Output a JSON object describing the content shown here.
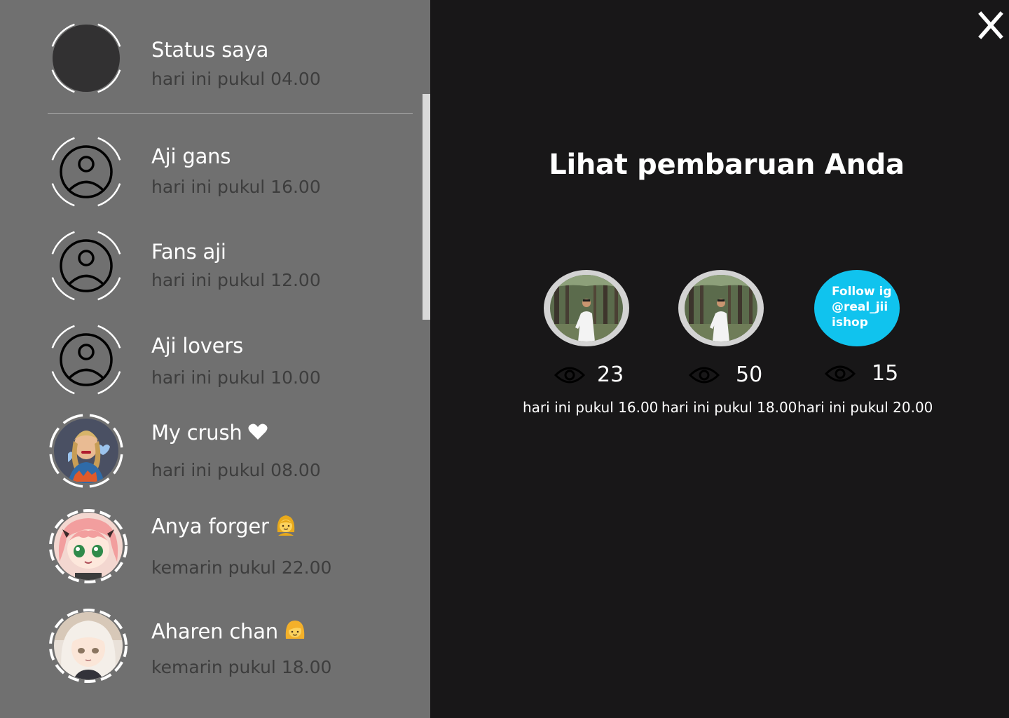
{
  "status_list": {
    "my_status": {
      "name": "Status saya",
      "time": "hari ini pukul 04.00"
    },
    "contacts": [
      {
        "name": "Aji gans",
        "time": "hari ini pukul 16.00"
      },
      {
        "name": "Fans aji",
        "time": "hari ini pukul 12.00"
      },
      {
        "name": "Aji lovers",
        "time": "hari ini pukul 10.00"
      },
      {
        "name": "My crush",
        "time": "hari ini pukul 08.00",
        "icon": "heart-icon"
      },
      {
        "name": "Anya forger",
        "time": "kemarin pukul 22.00",
        "icon": "girl-emoji-icon"
      },
      {
        "name": "Aharen chan",
        "time": "kemarin pukul 18.00",
        "icon": "blonde-girl-emoji-icon"
      }
    ]
  },
  "viewer": {
    "close_label": "X",
    "title": "Lihat pembaruan Anda",
    "updates": [
      {
        "views": "23",
        "time": "hari ini pukul 16.00",
        "kind": "photo"
      },
      {
        "views": "50",
        "time": "hari ini pukul 18.00",
        "kind": "photo"
      },
      {
        "views": "15",
        "time": "hari ini pukul 20.00",
        "kind": "text",
        "text": "Follow ig @real_jii ishop"
      }
    ]
  },
  "colors": {
    "sidebar_bg": "#707070",
    "viewer_bg": "#181718",
    "text_status_bg": "#10c3ee",
    "muted_text": "#3d3d3d"
  }
}
